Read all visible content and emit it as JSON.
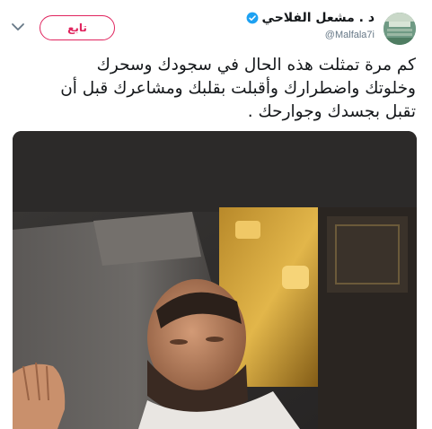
{
  "author": {
    "display_name": "د . مشعل الفلاحي",
    "handle": "@Malfala7i",
    "verified": true,
    "avatar_icon": "avatar-photo"
  },
  "actions": {
    "follow_label": "تابع",
    "menu_icon": "chevron-down-icon"
  },
  "tweet": {
    "text": "كم مرة تمثلت هذه الحال في سجودك وسحرك\nوخلوتك واضطرارك وأقبلت بقلبك ومشاعرك قبل أن\nتقبل بجسدك وجوارحك ."
  },
  "media": {
    "description_icon": "photo"
  },
  "colors": {
    "follow_accent": "#e0245e",
    "verified_blue": "#1da1f2",
    "handle_gray": "#657786"
  }
}
